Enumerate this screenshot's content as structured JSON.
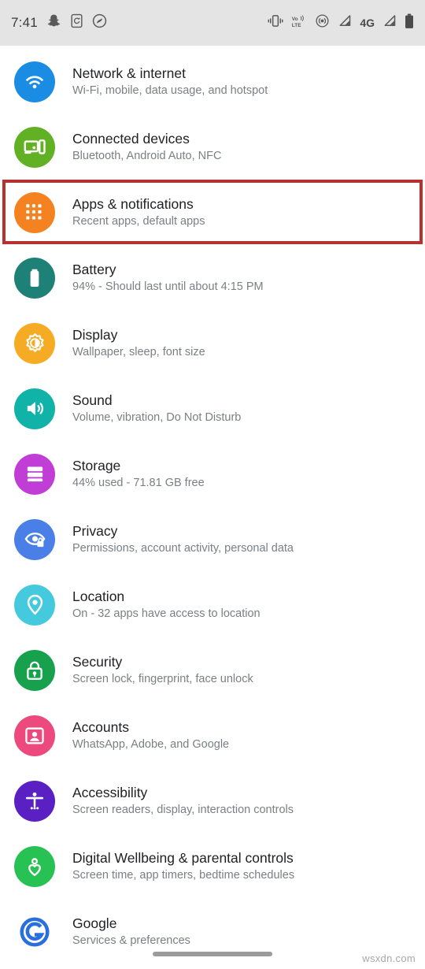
{
  "status_bar": {
    "time": "7:41",
    "left_icons": [
      "snapchat-icon",
      "screenshot-icon",
      "shazam-icon"
    ],
    "right_icons": [
      "vibrate-icon",
      "volte-icon",
      "hotspot-icon",
      "signal-sim1-icon",
      "network-4g-icon",
      "signal-sim2-icon",
      "battery-icon"
    ],
    "volte_label": "VoLTE",
    "network_label": "4G",
    "background": "#e4e4e4"
  },
  "highlight": {
    "color": "#b93030",
    "target": "Apps & notifications"
  },
  "settings": {
    "items": [
      {
        "title": "Network & internet",
        "subtitle": "Wi-Fi, mobile, data usage, and hotspot",
        "icon": "wifi-icon",
        "color": "#1b8ce3",
        "highlighted": false
      },
      {
        "title": "Connected devices",
        "subtitle": "Bluetooth, Android Auto, NFC",
        "icon": "cast-devices-icon",
        "color": "#62b023",
        "highlighted": false
      },
      {
        "title": "Apps & notifications",
        "subtitle": "Recent apps, default apps",
        "icon": "apps-grid-icon",
        "color": "#f58220",
        "highlighted": true
      },
      {
        "title": "Battery",
        "subtitle": "94% - Should last until about 4:15 PM",
        "icon": "battery-icon",
        "color": "#1d8177",
        "highlighted": false
      },
      {
        "title": "Display",
        "subtitle": "Wallpaper, sleep, font size",
        "icon": "brightness-icon",
        "color": "#f5ab23",
        "highlighted": false
      },
      {
        "title": "Sound",
        "subtitle": "Volume, vibration, Do Not Disturb",
        "icon": "speaker-icon",
        "color": "#11b3a8",
        "highlighted": false
      },
      {
        "title": "Storage",
        "subtitle": "44% used - 71.81 GB free",
        "icon": "storage-icon",
        "color": "#c03ed6",
        "highlighted": false
      },
      {
        "title": "Privacy",
        "subtitle": "Permissions, account activity, personal data",
        "icon": "privacy-eye-icon",
        "color": "#4a7fe8",
        "highlighted": false
      },
      {
        "title": "Location",
        "subtitle": "On - 32 apps have access to location",
        "icon": "location-pin-icon",
        "color": "#45c9dd",
        "highlighted": false
      },
      {
        "title": "Security",
        "subtitle": "Screen lock, fingerprint, face unlock",
        "icon": "lock-icon",
        "color": "#17a14c",
        "highlighted": false
      },
      {
        "title": "Accounts",
        "subtitle": "WhatsApp, Adobe, and Google",
        "icon": "account-icon",
        "color": "#ec4a7e",
        "highlighted": false
      },
      {
        "title": "Accessibility",
        "subtitle": "Screen readers, display, interaction controls",
        "icon": "accessibility-icon",
        "color": "#5a20c4",
        "highlighted": false
      },
      {
        "title": "Digital Wellbeing & parental controls",
        "subtitle": "Screen time, app timers, bedtime schedules",
        "icon": "wellbeing-heart-icon",
        "color": "#28c153",
        "highlighted": false
      },
      {
        "title": "Google",
        "subtitle": "Services & preferences",
        "icon": "google-g-icon",
        "color": "#2a6fe0",
        "highlighted": false
      }
    ]
  },
  "navigation": {
    "gesture_bar": "home-gesture-bar"
  },
  "watermark": {
    "text": "wsxdn.com"
  }
}
